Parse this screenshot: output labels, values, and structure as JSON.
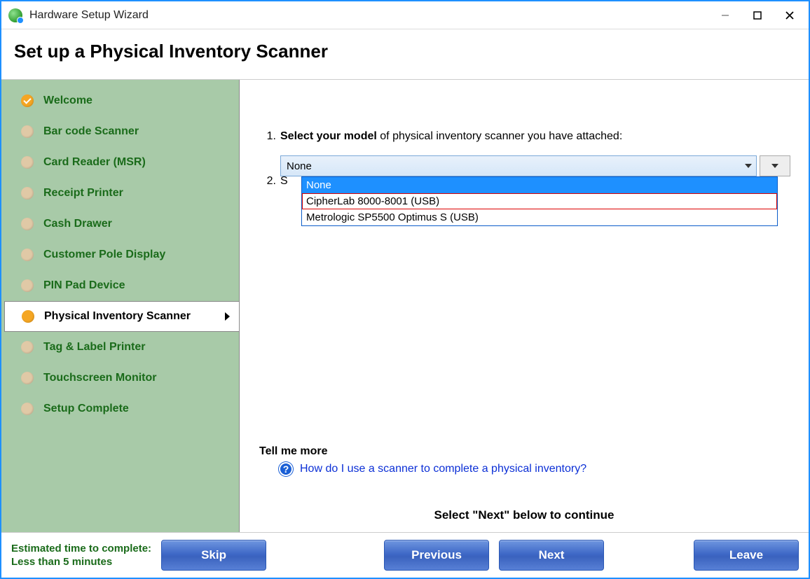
{
  "window": {
    "title": "Hardware Setup Wizard"
  },
  "header": {
    "title": "Set up a Physical Inventory Scanner"
  },
  "sidebar": {
    "items": [
      {
        "label": "Welcome",
        "state": "completed"
      },
      {
        "label": "Bar code Scanner",
        "state": "pending"
      },
      {
        "label": "Card Reader (MSR)",
        "state": "pending"
      },
      {
        "label": "Receipt Printer",
        "state": "pending"
      },
      {
        "label": "Cash Drawer",
        "state": "pending"
      },
      {
        "label": "Customer Pole Display",
        "state": "pending"
      },
      {
        "label": "PIN Pad Device",
        "state": "pending"
      },
      {
        "label": "Physical Inventory Scanner",
        "state": "active"
      },
      {
        "label": "Tag & Label Printer",
        "state": "pending"
      },
      {
        "label": "Touchscreen Monitor",
        "state": "pending"
      },
      {
        "label": "Setup Complete",
        "state": "pending"
      }
    ]
  },
  "main": {
    "step1": {
      "number": "1.",
      "label_bold": "Select your model",
      "label_rest": " of physical inventory scanner you have attached:"
    },
    "step2": {
      "number": "2.",
      "partial": "S"
    },
    "combo": {
      "selected": "None",
      "options": [
        "None",
        "CipherLab 8000-8001 (USB)",
        "Metrologic SP5500 Optimus S (USB)"
      ],
      "highlighted_index": 0,
      "hover_index": 1
    },
    "tell_more": {
      "heading": "Tell me more",
      "help_icon": "?",
      "link": "How do I use a scanner to complete a physical inventory?"
    },
    "continue_hint": "Select \"Next\" below to continue"
  },
  "footer": {
    "eta_label": "Estimated time to complete:",
    "eta_value": "Less than 5 minutes",
    "buttons": {
      "skip": "Skip",
      "previous": "Previous",
      "next": "Next",
      "leave": "Leave"
    }
  }
}
